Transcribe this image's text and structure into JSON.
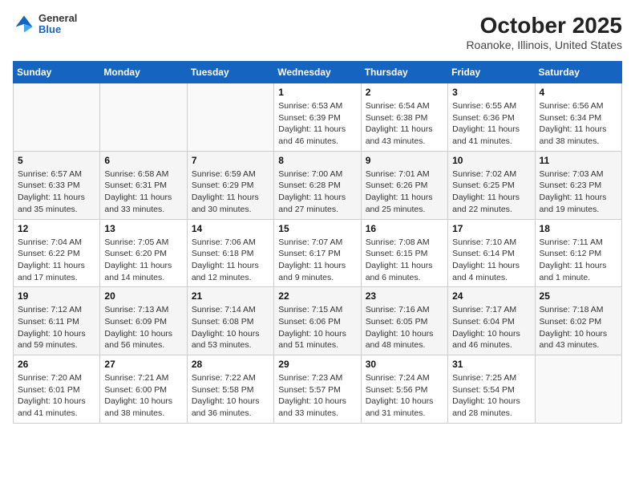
{
  "header": {
    "logo": {
      "general": "General",
      "blue": "Blue"
    },
    "title": "October 2025",
    "subtitle": "Roanoke, Illinois, United States"
  },
  "weekdays": [
    "Sunday",
    "Monday",
    "Tuesday",
    "Wednesday",
    "Thursday",
    "Friday",
    "Saturday"
  ],
  "weeks": [
    [
      {
        "date": "",
        "info": ""
      },
      {
        "date": "",
        "info": ""
      },
      {
        "date": "",
        "info": ""
      },
      {
        "date": "1",
        "info": "Sunrise: 6:53 AM\nSunset: 6:39 PM\nDaylight: 11 hours and 46 minutes."
      },
      {
        "date": "2",
        "info": "Sunrise: 6:54 AM\nSunset: 6:38 PM\nDaylight: 11 hours and 43 minutes."
      },
      {
        "date": "3",
        "info": "Sunrise: 6:55 AM\nSunset: 6:36 PM\nDaylight: 11 hours and 41 minutes."
      },
      {
        "date": "4",
        "info": "Sunrise: 6:56 AM\nSunset: 6:34 PM\nDaylight: 11 hours and 38 minutes."
      }
    ],
    [
      {
        "date": "5",
        "info": "Sunrise: 6:57 AM\nSunset: 6:33 PM\nDaylight: 11 hours and 35 minutes."
      },
      {
        "date": "6",
        "info": "Sunrise: 6:58 AM\nSunset: 6:31 PM\nDaylight: 11 hours and 33 minutes."
      },
      {
        "date": "7",
        "info": "Sunrise: 6:59 AM\nSunset: 6:29 PM\nDaylight: 11 hours and 30 minutes."
      },
      {
        "date": "8",
        "info": "Sunrise: 7:00 AM\nSunset: 6:28 PM\nDaylight: 11 hours and 27 minutes."
      },
      {
        "date": "9",
        "info": "Sunrise: 7:01 AM\nSunset: 6:26 PM\nDaylight: 11 hours and 25 minutes."
      },
      {
        "date": "10",
        "info": "Sunrise: 7:02 AM\nSunset: 6:25 PM\nDaylight: 11 hours and 22 minutes."
      },
      {
        "date": "11",
        "info": "Sunrise: 7:03 AM\nSunset: 6:23 PM\nDaylight: 11 hours and 19 minutes."
      }
    ],
    [
      {
        "date": "12",
        "info": "Sunrise: 7:04 AM\nSunset: 6:22 PM\nDaylight: 11 hours and 17 minutes."
      },
      {
        "date": "13",
        "info": "Sunrise: 7:05 AM\nSunset: 6:20 PM\nDaylight: 11 hours and 14 minutes."
      },
      {
        "date": "14",
        "info": "Sunrise: 7:06 AM\nSunset: 6:18 PM\nDaylight: 11 hours and 12 minutes."
      },
      {
        "date": "15",
        "info": "Sunrise: 7:07 AM\nSunset: 6:17 PM\nDaylight: 11 hours and 9 minutes."
      },
      {
        "date": "16",
        "info": "Sunrise: 7:08 AM\nSunset: 6:15 PM\nDaylight: 11 hours and 6 minutes."
      },
      {
        "date": "17",
        "info": "Sunrise: 7:10 AM\nSunset: 6:14 PM\nDaylight: 11 hours and 4 minutes."
      },
      {
        "date": "18",
        "info": "Sunrise: 7:11 AM\nSunset: 6:12 PM\nDaylight: 11 hours and 1 minute."
      }
    ],
    [
      {
        "date": "19",
        "info": "Sunrise: 7:12 AM\nSunset: 6:11 PM\nDaylight: 10 hours and 59 minutes."
      },
      {
        "date": "20",
        "info": "Sunrise: 7:13 AM\nSunset: 6:09 PM\nDaylight: 10 hours and 56 minutes."
      },
      {
        "date": "21",
        "info": "Sunrise: 7:14 AM\nSunset: 6:08 PM\nDaylight: 10 hours and 53 minutes."
      },
      {
        "date": "22",
        "info": "Sunrise: 7:15 AM\nSunset: 6:06 PM\nDaylight: 10 hours and 51 minutes."
      },
      {
        "date": "23",
        "info": "Sunrise: 7:16 AM\nSunset: 6:05 PM\nDaylight: 10 hours and 48 minutes."
      },
      {
        "date": "24",
        "info": "Sunrise: 7:17 AM\nSunset: 6:04 PM\nDaylight: 10 hours and 46 minutes."
      },
      {
        "date": "25",
        "info": "Sunrise: 7:18 AM\nSunset: 6:02 PM\nDaylight: 10 hours and 43 minutes."
      }
    ],
    [
      {
        "date": "26",
        "info": "Sunrise: 7:20 AM\nSunset: 6:01 PM\nDaylight: 10 hours and 41 minutes."
      },
      {
        "date": "27",
        "info": "Sunrise: 7:21 AM\nSunset: 6:00 PM\nDaylight: 10 hours and 38 minutes."
      },
      {
        "date": "28",
        "info": "Sunrise: 7:22 AM\nSunset: 5:58 PM\nDaylight: 10 hours and 36 minutes."
      },
      {
        "date": "29",
        "info": "Sunrise: 7:23 AM\nSunset: 5:57 PM\nDaylight: 10 hours and 33 minutes."
      },
      {
        "date": "30",
        "info": "Sunrise: 7:24 AM\nSunset: 5:56 PM\nDaylight: 10 hours and 31 minutes."
      },
      {
        "date": "31",
        "info": "Sunrise: 7:25 AM\nSunset: 5:54 PM\nDaylight: 10 hours and 28 minutes."
      },
      {
        "date": "",
        "info": ""
      }
    ]
  ]
}
